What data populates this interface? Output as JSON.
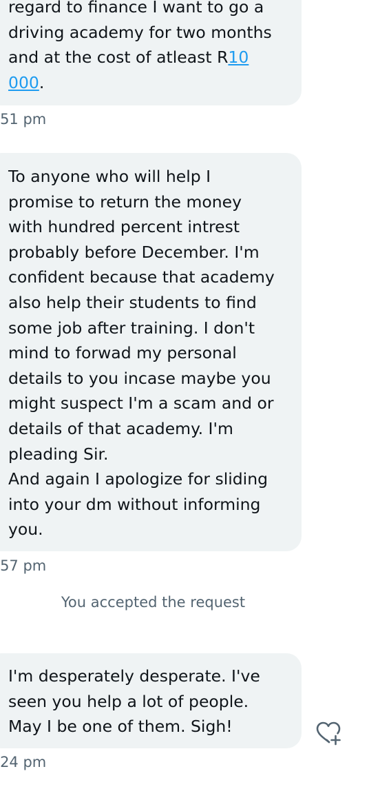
{
  "messages": [
    {
      "text_before_link": "regard to finance I want to go a\ndriving academy for two months\nand at the cost of atleast R",
      "link_text": "10\n000",
      "text_after_link": ".",
      "timestamp": ":51 pm"
    },
    {
      "text": "To anyone who will help I\npromise to return the money\nwith hundred percent intrest\nprobably before December. I'm\nconfident because that academy\nalso help their students to find\nsome job after training. I don't\nmind to forwad my personal\ndetails to you incase maybe you\nmight suspect I'm a scam and or\ndetails of that academy. I'm\npleading Sir.\nAnd again I apologize for sliding\ninto your dm without informing\nyou.",
      "timestamp": ":57 pm"
    },
    {
      "text": "I'm desperately desperate. I've\nseen you help a lot of people.\nMay I be one of them. Sigh!",
      "timestamp": ":24 pm"
    }
  ],
  "system_note": "You accepted the request",
  "react_button": {
    "icon": "heart-plus-icon"
  },
  "colors": {
    "bubble_background": "#eff3f4",
    "text": "#0f1419",
    "secondary_text": "#536471",
    "link": "#1d9bf0"
  }
}
